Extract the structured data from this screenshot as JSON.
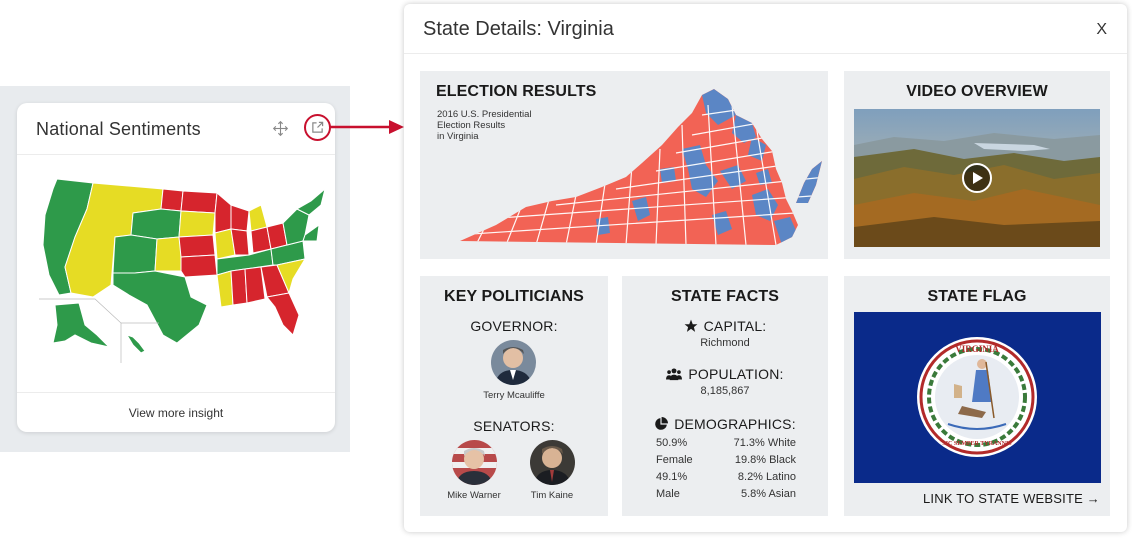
{
  "widget": {
    "title": "National Sentiments",
    "footer": "View more insight",
    "icons": {
      "move": "move-icon",
      "popout": "external-link-icon"
    },
    "map_colors": {
      "green": "#2e9a4a",
      "yellow": "#e6dc24",
      "red": "#d6252d"
    }
  },
  "modal": {
    "title": "State Details: Virginia",
    "close": "X"
  },
  "election": {
    "title": "ELECTION RESULTS",
    "subtitle_line1": "2016 U.S. Presidential",
    "subtitle_line2": "Election Results",
    "subtitle_line3": "in Virginia",
    "colors": {
      "republican": "#f26355",
      "democrat": "#5b86c5"
    }
  },
  "video": {
    "title": "VIDEO OVERVIEW",
    "play_icon": "play-icon"
  },
  "politicians": {
    "title": "KEY POLITICIANS",
    "governor_label": "GOVERNOR:",
    "governor_name": "Terry Mcauliffe",
    "senators_label": "SENATORS:",
    "senator1_name": "Mike Warner",
    "senator2_name": "Tim Kaine"
  },
  "facts": {
    "title": "STATE FACTS",
    "capital_label": "CAPITAL:",
    "capital_value": "Richmond",
    "population_label": "POPULATION:",
    "population_value": "8,185,867",
    "demographics_label": "DEMOGRAPHICS:",
    "demographics": [
      {
        "left": "50.9%",
        "right": "71.3% White"
      },
      {
        "left": "Female",
        "right": "19.8% Black"
      },
      {
        "left": "49.1%",
        "right": "8.2% Latino"
      },
      {
        "left": "Male",
        "right": "5.8% Asian"
      }
    ]
  },
  "flag": {
    "title": "STATE FLAG",
    "link": "LINK TO STATE WEBSITE →",
    "seal_top": "VIRGINIA",
    "seal_bottom": "SIC SEMPER TYRANNIS"
  }
}
